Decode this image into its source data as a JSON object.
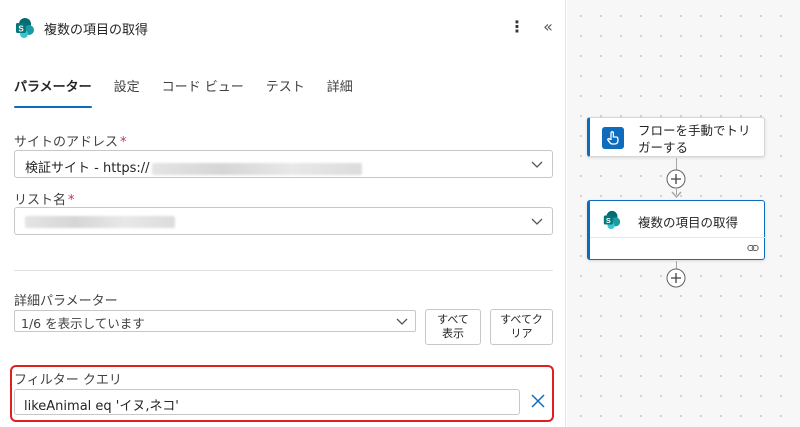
{
  "panel": {
    "title": "複数の項目の取得",
    "more_icon": "more-vertical-icon",
    "collapse_icon": "double-chevron-left-icon",
    "tabs": [
      {
        "label": "パラメーター",
        "active": true
      },
      {
        "label": "設定",
        "active": false
      },
      {
        "label": "コード ビュー",
        "active": false
      },
      {
        "label": "テスト",
        "active": false
      },
      {
        "label": "詳細",
        "active": false
      }
    ],
    "site_address": {
      "label": "サイトのアドレス",
      "required_mark": "*",
      "value": "検証サイト - https://"
    },
    "list_name": {
      "label": "リスト名",
      "required_mark": "*",
      "value": ""
    },
    "advanced": {
      "label": "詳細パラメーター",
      "selected": "1/6 を表示しています",
      "show_all_line1": "すべて",
      "show_all_line2": "表示",
      "clear_all_line1": "すべてク",
      "clear_all_line2": "リア"
    },
    "filter_query": {
      "label": "フィルター クエリ",
      "value": "likeAnimal eq 'イヌ,ネコ'"
    }
  },
  "canvas": {
    "trigger_card": {
      "title_line1": "フローを手動でトリ",
      "title_line2": "ガーする",
      "icon": "touch-icon"
    },
    "action_card": {
      "title": "複数の項目の取得",
      "icon": "sharepoint-icon",
      "footer_icon": "link-icon"
    }
  },
  "colors": {
    "accent": "#0f6cbd",
    "highlight_border": "#e02020",
    "sharepoint": "#038387"
  }
}
